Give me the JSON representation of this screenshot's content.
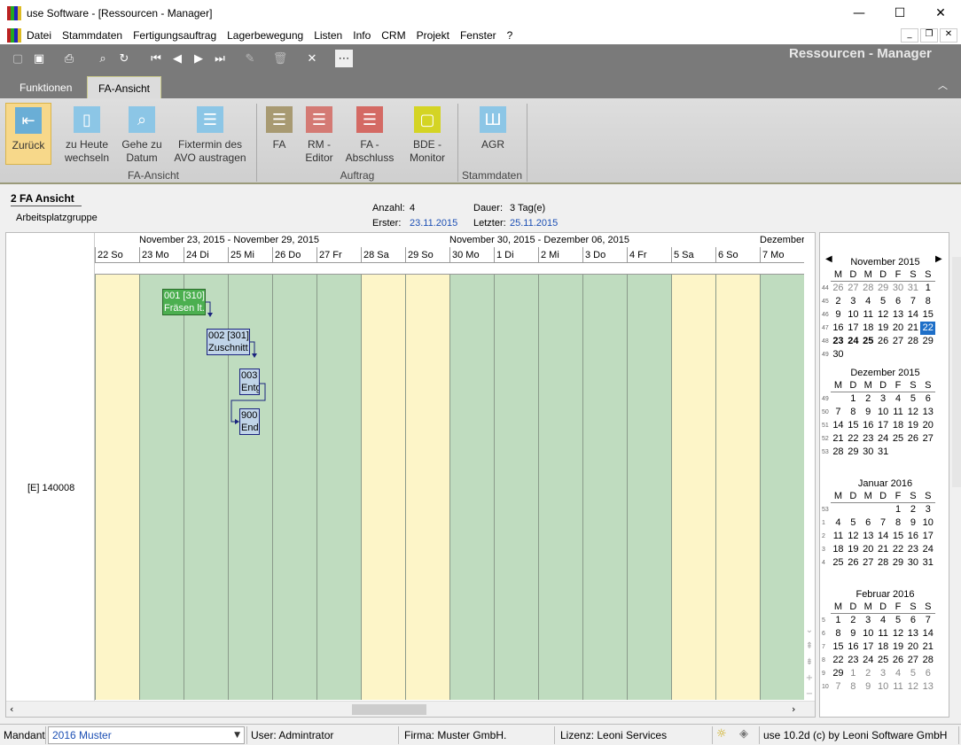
{
  "window": {
    "title": "use Software - [Ressourcen - Manager]",
    "minimize": "—",
    "maximize": "☐",
    "close": "✕"
  },
  "menu": [
    "Datei",
    "Stammdaten",
    "Fertigungsauftrag",
    "Lagerbewegung",
    "Listen",
    "Info",
    "CRM",
    "Projekt",
    "Fenster",
    "?"
  ],
  "header_title": "Ressourcen - Manager",
  "tabs": [
    "Funktionen",
    "FA-Ansicht"
  ],
  "ribbon": {
    "buttons": [
      {
        "label1": "Zurück",
        "label2": "",
        "color": "#6aaed6"
      },
      {
        "label1": "zu Heute",
        "label2": "wechseln",
        "color": "#8cc6e6"
      },
      {
        "label1": "Gehe zu",
        "label2": "Datum",
        "color": "#8cc6e6"
      },
      {
        "label1": "Fixtermin des",
        "label2": "AVO austragen",
        "color": "#8cc6e6"
      },
      {
        "label1": "FA",
        "label2": "",
        "color": "#a89a72"
      },
      {
        "label1": "RM -",
        "label2": "Editor",
        "color": "#d47a74"
      },
      {
        "label1": "FA -",
        "label2": "Abschluss",
        "color": "#d46a64"
      },
      {
        "label1": "BDE -",
        "label2": "Monitor",
        "color": "#d4d424"
      },
      {
        "label1": "AGR",
        "label2": "",
        "color": "#8cc6e6"
      }
    ],
    "groups": [
      "FA-Ansicht",
      "Auftrag",
      "Stammdaten"
    ]
  },
  "section": {
    "title": "2 FA Ansicht",
    "subtitle": "Arbeitsplatzgruppe"
  },
  "info": {
    "anzahl_label": "Anzahl:",
    "anzahl": "4",
    "dauer_label": "Dauer:",
    "dauer": "3 Tag(e)",
    "erster_label": "Erster:",
    "erster": "23.11.2015",
    "letzter_label": "Letzter:",
    "letzter": "25.11.2015"
  },
  "weeks": [
    "November 23, 2015 - November 29, 2015",
    "November 30, 2015 - Dezember 06, 2015",
    "Dezember"
  ],
  "days": [
    "22 So",
    "23 Mo",
    "24 Di",
    "25 Mi",
    "26 Do",
    "27 Fr",
    "28 Sa",
    "29 So",
    "30 Mo",
    "1 Di",
    "2 Mi",
    "3 Do",
    "4 Fr",
    "5 Sa",
    "6 So",
    "7 Mo"
  ],
  "resource": "[E] 140008",
  "tasks": [
    {
      "line1": "001 [310]",
      "line2": "Fräsen lt."
    },
    {
      "line1": "002 [301]",
      "line2": "Zuschnitt"
    },
    {
      "line1": "003",
      "line2": "Entg"
    },
    {
      "line1": "900",
      "line2": "Endi"
    }
  ],
  "calendar": {
    "weekdays": [
      "M",
      "D",
      "M",
      "D",
      "F",
      "S",
      "S"
    ],
    "months": [
      {
        "name": "November 2015",
        "weeks": [
          [
            "44",
            "26",
            "27",
            "28",
            "29",
            "30",
            "31",
            "1"
          ],
          [
            "45",
            "2",
            "3",
            "4",
            "5",
            "6",
            "7",
            "8"
          ],
          [
            "46",
            "9",
            "10",
            "11",
            "12",
            "13",
            "14",
            "15"
          ],
          [
            "47",
            "16",
            "17",
            "18",
            "19",
            "20",
            "21",
            "22"
          ],
          [
            "48",
            "23",
            "24",
            "25",
            "26",
            "27",
            "28",
            "29"
          ],
          [
            "49",
            "30",
            "",
            "",
            "",
            "",
            "",
            ""
          ]
        ]
      },
      {
        "name": "Dezember 2015",
        "weeks": [
          [
            "49",
            "",
            "1",
            "2",
            "3",
            "4",
            "5",
            "6"
          ],
          [
            "50",
            "7",
            "8",
            "9",
            "10",
            "11",
            "12",
            "13"
          ],
          [
            "51",
            "14",
            "15",
            "16",
            "17",
            "18",
            "19",
            "20"
          ],
          [
            "52",
            "21",
            "22",
            "23",
            "24",
            "25",
            "26",
            "27"
          ],
          [
            "53",
            "28",
            "29",
            "30",
            "31",
            "",
            "",
            ""
          ]
        ]
      },
      {
        "name": "Januar 2016",
        "weeks": [
          [
            "53",
            "",
            "",
            "",
            "",
            "1",
            "2",
            "3"
          ],
          [
            "1",
            "4",
            "5",
            "6",
            "7",
            "8",
            "9",
            "10"
          ],
          [
            "2",
            "11",
            "12",
            "13",
            "14",
            "15",
            "16",
            "17"
          ],
          [
            "3",
            "18",
            "19",
            "20",
            "21",
            "22",
            "23",
            "24"
          ],
          [
            "4",
            "25",
            "26",
            "27",
            "28",
            "29",
            "30",
            "31"
          ]
        ]
      },
      {
        "name": "Februar 2016",
        "weeks": [
          [
            "5",
            "1",
            "2",
            "3",
            "4",
            "5",
            "6",
            "7"
          ],
          [
            "6",
            "8",
            "9",
            "10",
            "11",
            "12",
            "13",
            "14"
          ],
          [
            "7",
            "15",
            "16",
            "17",
            "18",
            "19",
            "20",
            "21"
          ],
          [
            "8",
            "22",
            "23",
            "24",
            "25",
            "26",
            "27",
            "28"
          ],
          [
            "9",
            "29",
            "1",
            "2",
            "3",
            "4",
            "5",
            "6"
          ],
          [
            "10",
            "7",
            "8",
            "9",
            "10",
            "11",
            "12",
            "13"
          ]
        ]
      }
    ]
  },
  "status": {
    "mandant_label": "Mandant",
    "mandant_value": "2016 Muster",
    "user": "User: Admintrator",
    "firma": "Firma: Muster GmbH.",
    "lizenz": "Lizenz: Leoni Services",
    "version": "use 10.2d (c) by Leoni Software GmbH"
  }
}
